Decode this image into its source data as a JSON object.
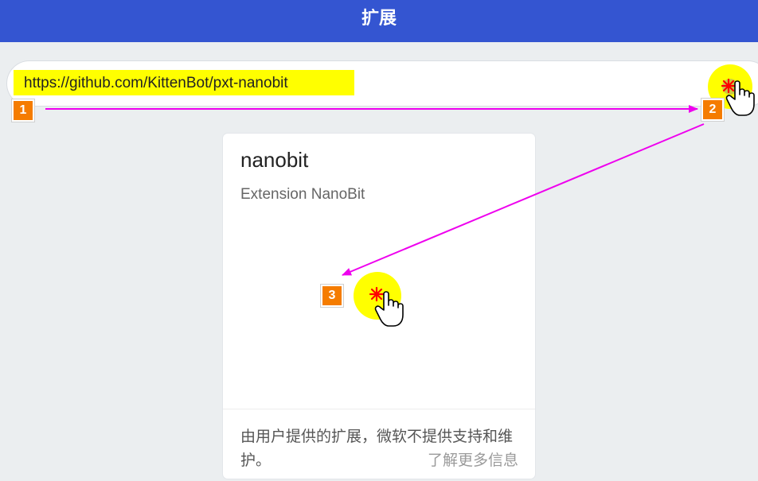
{
  "header": {
    "title": "扩展"
  },
  "search": {
    "value": "https://github.com/KittenBot/pxt-nanobit"
  },
  "card": {
    "title": "nanobit",
    "description": "Extension NanoBit",
    "footer_text": "由用户提供的扩展，微软不提供支持和维护。",
    "learn_more": "了解更多信息"
  },
  "annotations": {
    "steps": [
      "1",
      "2",
      "3"
    ],
    "arrow_color": "#ee00ee",
    "badge_color": "#f57c00",
    "highlight_color": "#ffff00",
    "click_marker_color": "#ff0000"
  },
  "colors": {
    "header_bg": "#3455d1",
    "page_bg": "#ebeef0"
  }
}
